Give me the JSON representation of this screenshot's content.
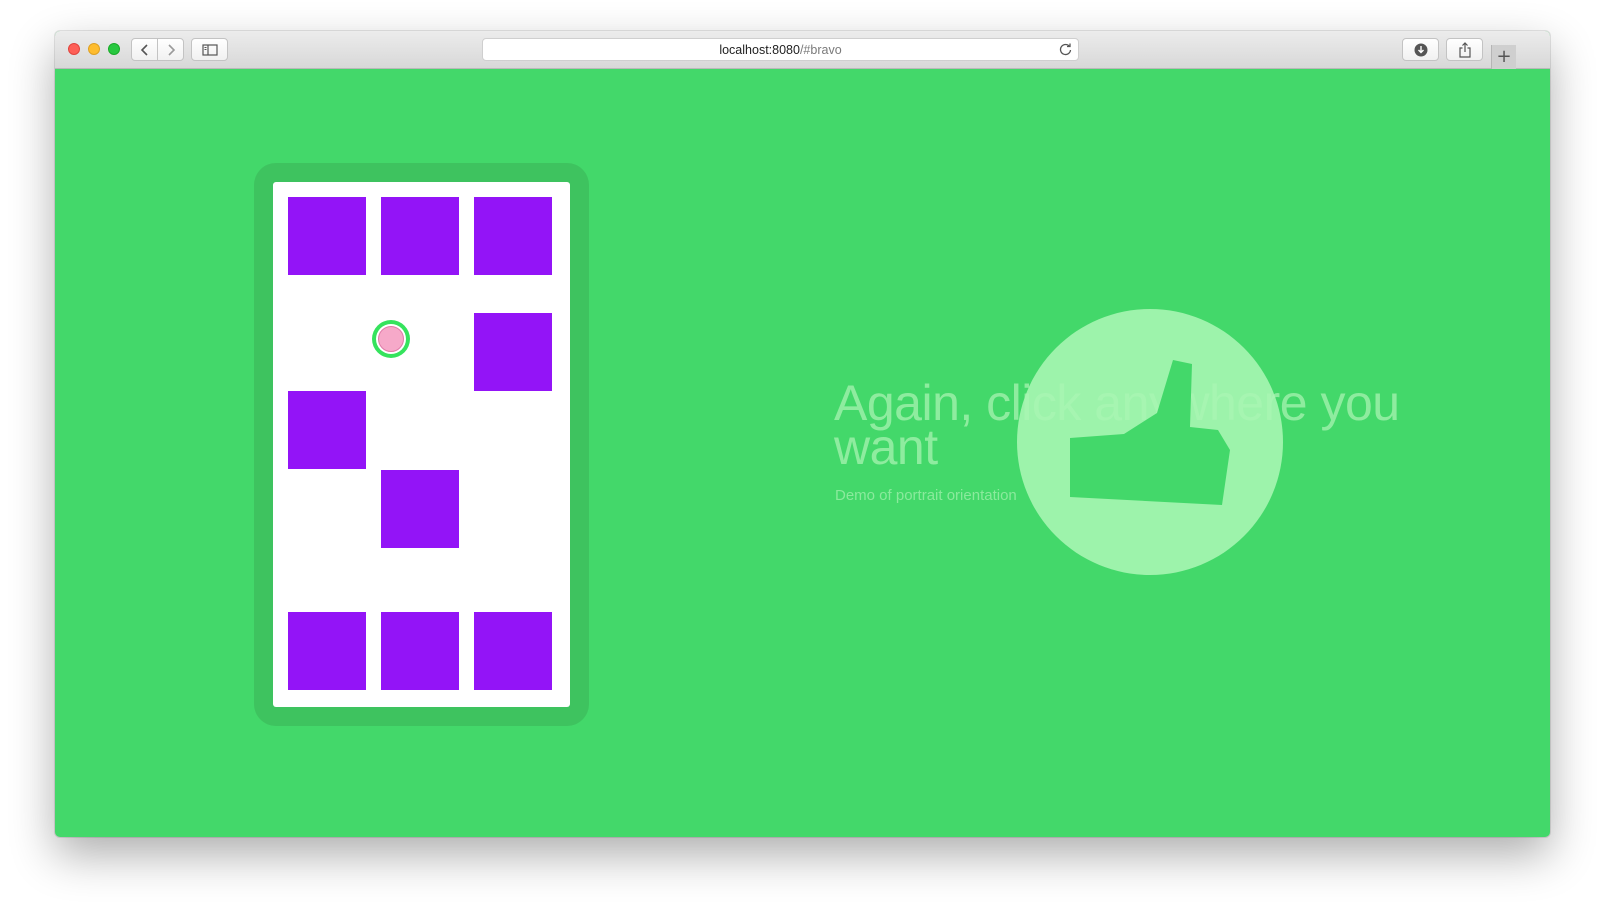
{
  "browser": {
    "url_host": "localhost:8080",
    "url_path": "/#bravo",
    "icons": {
      "back": "chevron-left-icon",
      "forward": "chevron-right-icon",
      "sidebar": "sidebar-icon",
      "reload": "reload-icon",
      "download": "download-icon",
      "share": "share-icon",
      "new_tab": "plus-icon"
    },
    "new_tab_glyph": "+"
  },
  "page": {
    "background_color": "#43d86a",
    "headline": "Again, click anywhere you want",
    "subtitle": "Demo of portrait orientation",
    "tile_color": "#9314f7",
    "ball_color": "#f6a9c9",
    "thumb_icon": "thumbs-up-icon"
  }
}
